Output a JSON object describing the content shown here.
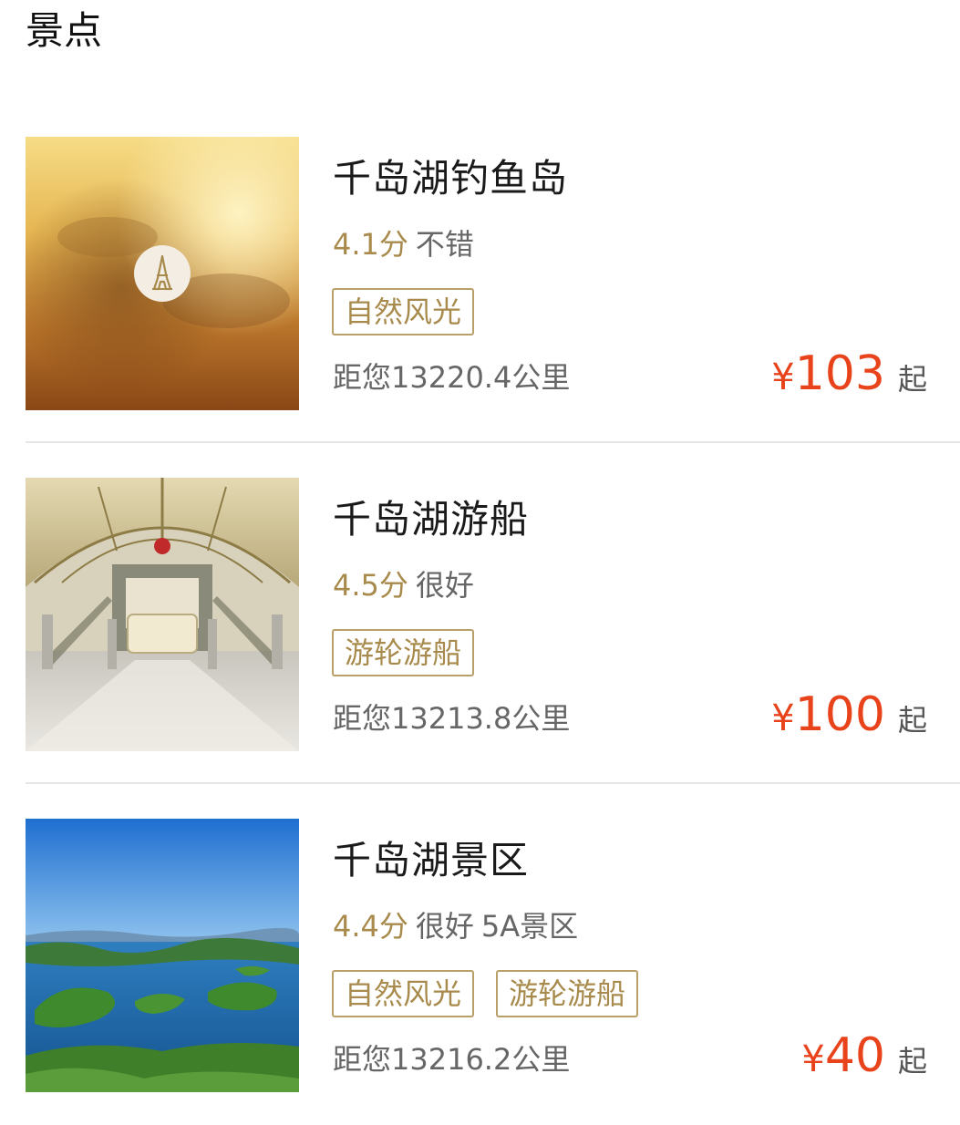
{
  "section": {
    "title": "景点"
  },
  "colors": {
    "gold": "#a88b4c",
    "price_red": "#e8431b",
    "gray_text": "#666666"
  },
  "attractions": [
    {
      "name": "千岛湖钓鱼岛",
      "score": "4.1分",
      "verdict": "不错",
      "extra": "",
      "tags": [
        "自然风光"
      ],
      "distance": "距您13220.4公里",
      "currency": "¥",
      "price": "103",
      "price_suffix": "起",
      "image": "placeholder-tower-icon"
    },
    {
      "name": "千岛湖游船",
      "score": "4.5分",
      "verdict": "很好",
      "extra": "",
      "tags": [
        "游轮游船"
      ],
      "distance": "距您13213.8公里",
      "currency": "¥",
      "price": "100",
      "price_suffix": "起",
      "image": "ship-interior-photo"
    },
    {
      "name": "千岛湖景区",
      "score": "4.4分",
      "verdict": "很好",
      "extra": "5A景区",
      "tags": [
        "自然风光",
        "游轮游船"
      ],
      "distance": "距您13216.2公里",
      "currency": "¥",
      "price": "40",
      "price_suffix": "起",
      "image": "lake-islands-photo"
    }
  ]
}
